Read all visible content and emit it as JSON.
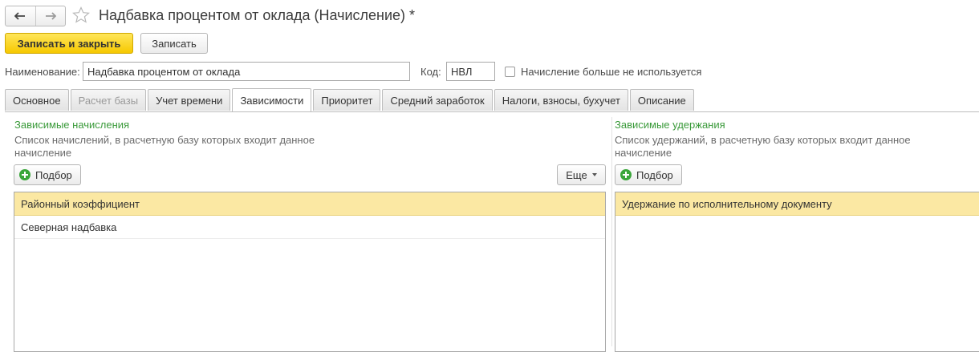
{
  "window": {
    "title": "Надбавка процентом от оклада (Начисление) *",
    "nav_back_icon": "arrow-left-icon",
    "nav_forward_icon": "arrow-right-icon",
    "favorite_icon": "star-icon"
  },
  "toolbar": {
    "save_close_label": "Записать и закрыть",
    "save_label": "Записать"
  },
  "form": {
    "name_label": "Наименование:",
    "name_value": "Надбавка процентом от оклада",
    "code_label": "Код:",
    "code_value": "НВЛ",
    "not_used_label": "Начисление больше не используется",
    "not_used_checked": false
  },
  "tabs": [
    {
      "label": "Основное",
      "state": "normal"
    },
    {
      "label": "Расчет базы",
      "state": "disabled"
    },
    {
      "label": "Учет времени",
      "state": "normal"
    },
    {
      "label": "Зависимости",
      "state": "active"
    },
    {
      "label": "Приоритет",
      "state": "normal"
    },
    {
      "label": "Средний заработок",
      "state": "normal"
    },
    {
      "label": "Налоги, взносы, бухучет",
      "state": "normal"
    },
    {
      "label": "Описание",
      "state": "normal"
    }
  ],
  "left_panel": {
    "title": "Зависимые начисления",
    "description": "Список начислений, в расчетную базу которых входит данное начисление",
    "add_button": "Подбор",
    "more_button": "Еще",
    "items": [
      {
        "label": "Районный коэффициент",
        "selected": true
      },
      {
        "label": "Северная надбавка",
        "selected": false
      }
    ]
  },
  "right_panel": {
    "title": "Зависимые удержания",
    "description": "Список удержаний, в расчетную базу которых входит данное начисление",
    "add_button": "Подбор",
    "items": [
      {
        "label": "Удержание по исполнительному документу",
        "selected": true
      }
    ]
  },
  "colors": {
    "primary_button": "#f6c800",
    "section_title": "#3a9a3a",
    "selected_row": "#fbe8a3"
  }
}
